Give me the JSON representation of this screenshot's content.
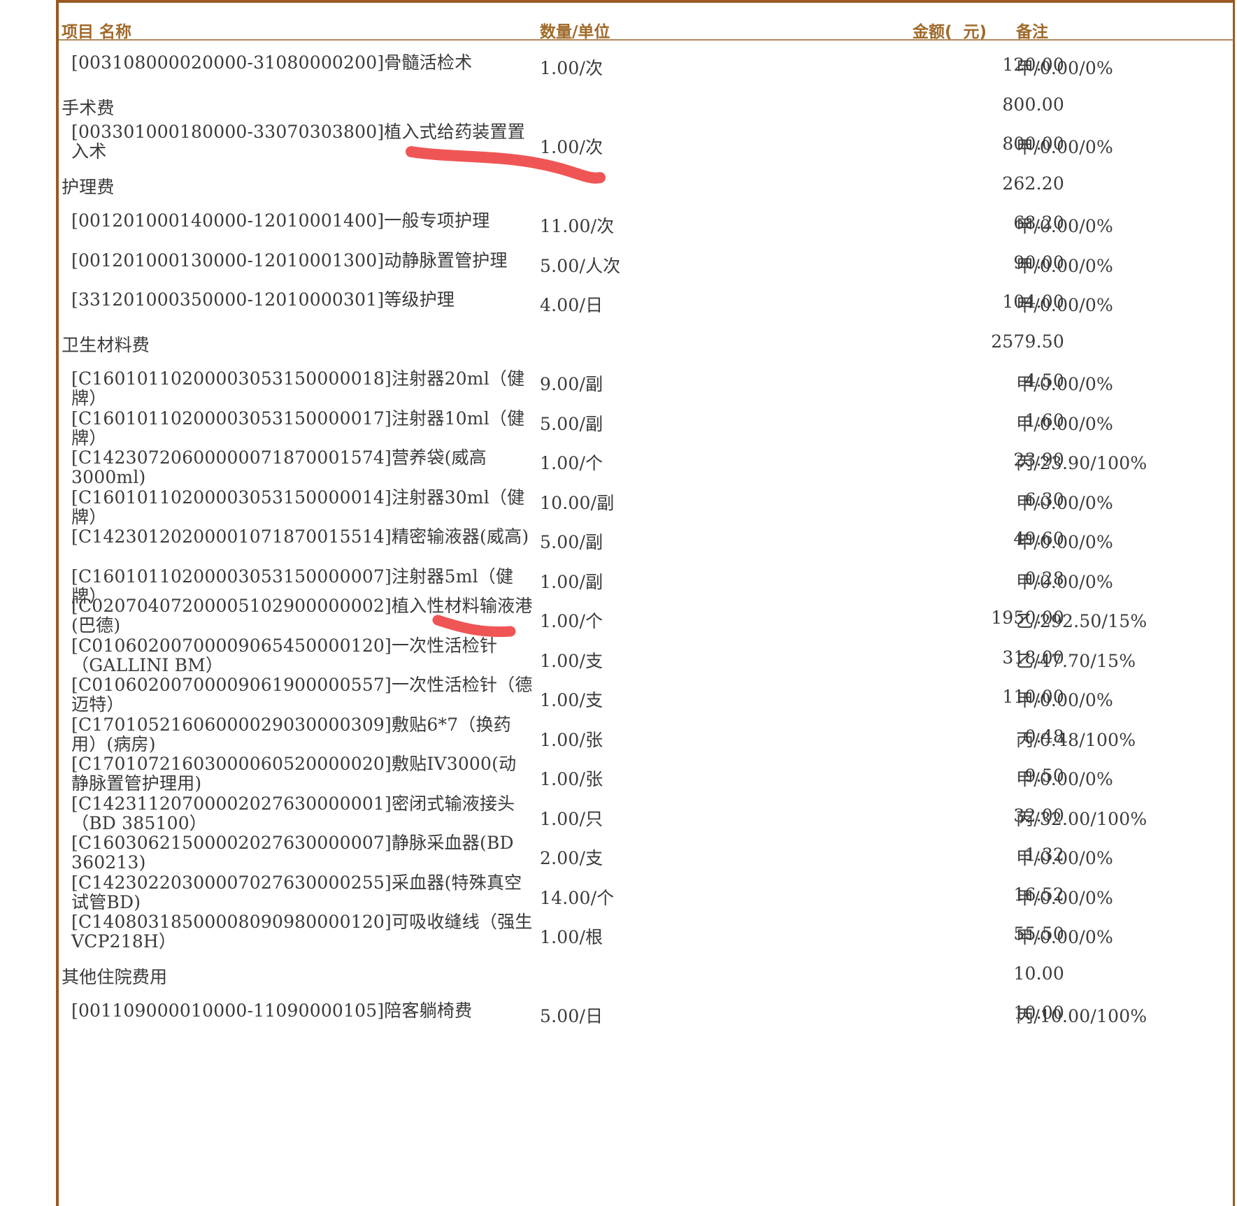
{
  "header": {
    "name": "项目 名称",
    "qty": "数量/单位",
    "amount": "金额(  元)",
    "note": "备注"
  },
  "rows": [
    {
      "type": "item",
      "name": "[003108000020000-31080000200]骨髓活检术",
      "qty": "1.00/次",
      "amount": "120.00",
      "note": "甲/0.00/0%"
    },
    {
      "type": "category",
      "name": "手术费",
      "amount": "800.00"
    },
    {
      "type": "item",
      "name": "[003301000180000-33070303800]植入式给药装置置入术",
      "qty": "1.00/次",
      "amount": "800.00",
      "note": "甲/0.00/0%"
    },
    {
      "type": "category",
      "name": "护理费",
      "amount": "262.20"
    },
    {
      "type": "item",
      "name": "[001201000140000-12010001400]一般专项护理",
      "qty": "11.00/次",
      "amount": "68.20",
      "note": "甲/0.00/0%"
    },
    {
      "type": "item",
      "name": "[001201000130000-12010001300]动静脉置管护理",
      "qty": "5.00/人次",
      "amount": "90.00",
      "note": "甲/0.00/0%"
    },
    {
      "type": "item",
      "name": "[331201000350000-12010000301]等级护理",
      "qty": "4.00/日",
      "amount": "104.00",
      "note": "甲/0.00/0%"
    },
    {
      "type": "category",
      "name": "卫生材料费",
      "amount": "2579.50"
    },
    {
      "type": "item",
      "name": "[C16010110200003053150000018]注射器20ml（健牌）",
      "qty": "9.00/副",
      "amount": "4.50",
      "note": "甲/0.00/0%"
    },
    {
      "type": "item",
      "name": "[C16010110200003053150000017]注射器10ml（健牌）",
      "qty": "5.00/副",
      "amount": "1.60",
      "note": "甲/0.00/0%"
    },
    {
      "type": "item",
      "name": "[C14230720600000071870001574]营养袋(威高 3000ml)",
      "qty": "1.00/个",
      "amount": "23.90",
      "note": "丙/23.90/100%"
    },
    {
      "type": "item",
      "name": "[C16010110200003053150000014]注射器30ml（健牌）",
      "qty": "10.00/副",
      "amount": "6.30",
      "note": "甲/0.00/0%"
    },
    {
      "type": "item",
      "name": "[C14230120200001071870015514]精密输液器(威高)",
      "qty": "5.00/副",
      "amount": "49.60",
      "note": "甲/0.00/0%"
    },
    {
      "type": "item",
      "name": "[C16010110200003053150000007]注射器5ml（健牌）",
      "qty": "1.00/副",
      "amount": "0.28",
      "note": "甲/0.00/0%"
    },
    {
      "type": "item",
      "name": "[C02070407200005102900000002]植入性材料输液港(巴德)",
      "qty": "1.00/个",
      "amount": "1950.00",
      "note": "乙/292.50/15%"
    },
    {
      "type": "item",
      "name": "[C01060200700009065450000120]一次性活检针（GALLINI BM）",
      "qty": "1.00/支",
      "amount": "318.00",
      "note": "乙/47.70/15%"
    },
    {
      "type": "item",
      "name": "[C01060200700009061900000557]一次性活检针（德迈特）",
      "qty": "1.00/支",
      "amount": "110.00",
      "note": "甲/0.00/0%"
    },
    {
      "type": "item",
      "name": "[C17010521606000029030000309]敷贴6*7（换药用）(病房)",
      "qty": "1.00/张",
      "amount": "0.48",
      "note": "丙/0.48/100%"
    },
    {
      "type": "item",
      "name": "[C17010721603000060520000020]敷贴IV3000(动静脉置管护理用)",
      "qty": "1.00/张",
      "amount": "9.50",
      "note": "甲/0.00/0%"
    },
    {
      "type": "item",
      "name": "[C14231120700002027630000001]密闭式输液接头（BD 385100）",
      "qty": "1.00/只",
      "amount": "32.00",
      "note": "丙/32.00/100%"
    },
    {
      "type": "item",
      "name": "[C16030621500002027630000007]静脉采血器(BD 360213)",
      "qty": "2.00/支",
      "amount": "1.32",
      "note": "甲/0.00/0%"
    },
    {
      "type": "item",
      "name": "[C14230220300007027630000255]采血器(特殊真空试管BD)",
      "qty": "14.00/个",
      "amount": "16.52",
      "note": "甲/0.00/0%"
    },
    {
      "type": "item",
      "name": "[C14080318500008090980000120]可吸收缝线（强生VCP218H）",
      "qty": "1.00/根",
      "amount": "55.50",
      "note": "甲/0.00/0%"
    },
    {
      "type": "category",
      "name": "其他住院费用",
      "amount": "10.00"
    },
    {
      "type": "item",
      "name": "[001109000010000-11090000105]陪客躺椅费",
      "qty": "5.00/日",
      "amount": "10.00",
      "note": "丙/10.00/100%"
    }
  ],
  "colors": {
    "frame": "#9a5a22",
    "header_text": "#a06a2a",
    "highlight_stroke": "#f05555"
  }
}
